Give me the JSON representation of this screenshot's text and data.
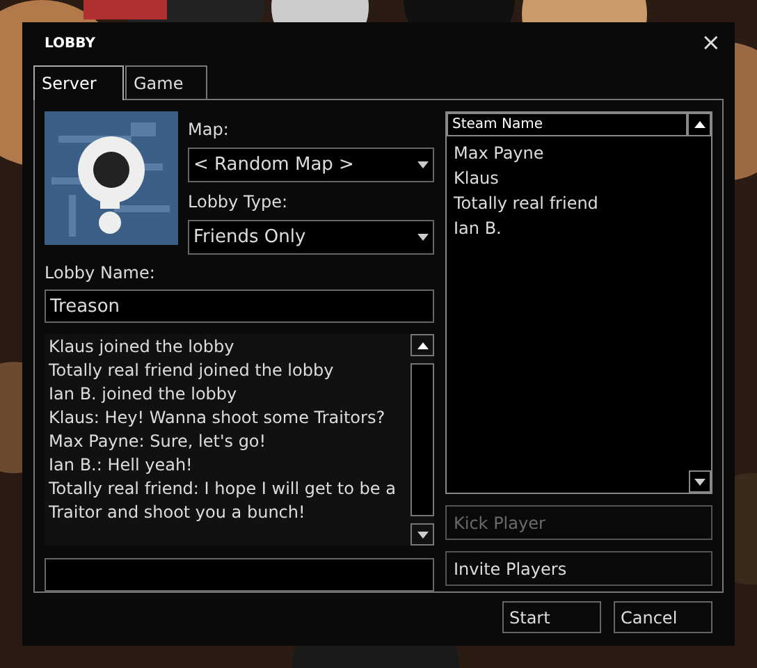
{
  "window": {
    "title": "LOBBY",
    "close": "×"
  },
  "tabs": [
    {
      "label": "Server",
      "selected": true
    },
    {
      "label": "Game",
      "selected": false
    }
  ],
  "map": {
    "label": "Map:",
    "value": "< Random Map >"
  },
  "lobby_type": {
    "label": "Lobby Type:",
    "value": "Friends Only"
  },
  "lobby_name": {
    "label": "Lobby Name:",
    "value": "Treason"
  },
  "chat": {
    "messages": [
      "Klaus joined the lobby",
      "Totally real friend joined the lobby",
      "Ian B. joined the lobby",
      "Klaus: Hey! Wanna shoot some Traitors?",
      "Max Payne: Sure, let's go!",
      "Ian B.: Hell yeah!",
      "Totally real friend: I hope I will get to be a Traitor and shoot you a bunch!"
    ]
  },
  "players": {
    "column": "Steam Name",
    "rows": [
      "Max Payne",
      "Klaus",
      "Totally real friend",
      "Ian B."
    ]
  },
  "player_buttons": [
    {
      "label": "Kick Player",
      "disabled": true
    },
    {
      "label": "Invite Players",
      "disabled": false
    }
  ],
  "footer_buttons": [
    {
      "label": "Start"
    },
    {
      "label": "Cancel"
    }
  ]
}
